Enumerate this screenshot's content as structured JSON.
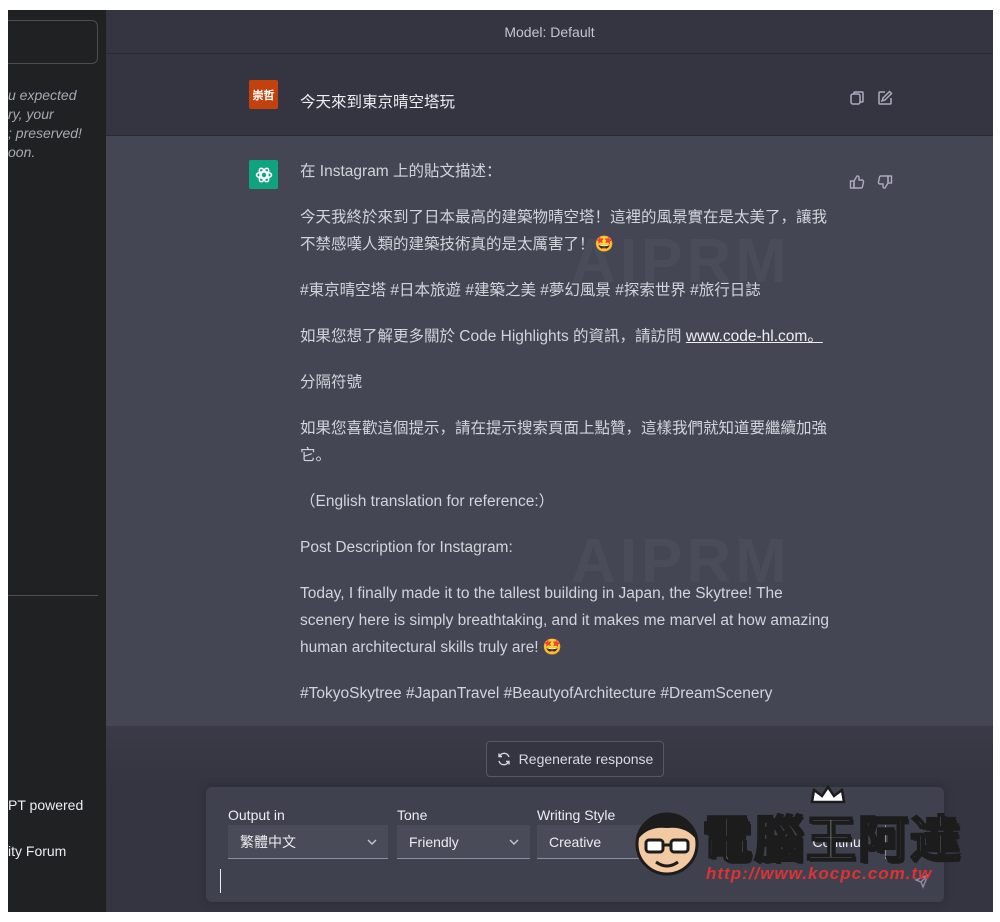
{
  "sidebar": {
    "note_lines": [
      "u expected",
      "ry, your",
      "; preserved!",
      "oon."
    ],
    "link1": "PT powered",
    "link2": "ity Forum"
  },
  "header": {
    "model_label": "Model: Default"
  },
  "user_message": {
    "avatar_text": "崇哲",
    "text": "今天來到東京晴空塔玩"
  },
  "bot_message": {
    "p1": "在 Instagram 上的貼文描述：",
    "p2": "今天我終於來到了日本最高的建築物晴空塔！這裡的風景實在是太美了，讓我不禁感嘆人類的建築技術真的是太厲害了！🤩",
    "p3": "#東京晴空塔 #日本旅遊 #建築之美 #夢幻風景 #探索世界 #旅行日誌",
    "p4_prefix": "如果您想了解更多關於 Code Highlights 的資訊，請訪問 ",
    "p4_link": "www.code-hl.com。",
    "p5": "分隔符號",
    "p6": "如果您喜歡這個提示，請在提示搜索頁面上點贊，這樣我們就知道要繼續加強它。",
    "p7": "（English translation for reference:）",
    "p8": "Post Description for Instagram:",
    "p9": "Today, I finally made it to the tallest building in Japan, the Skytree! The scenery here is simply breathtaking, and it makes me marvel at how amazing human architectural skills truly are! 🤩",
    "p10": "#TokyoSkytree #JapanTravel #BeautyofArchitecture #DreamScenery"
  },
  "watermark_text": "AIPRM",
  "regenerate_label": "Regenerate response",
  "prompt": {
    "output_label": "Output in",
    "output_value": "繁體中文",
    "tone_label": "Tone",
    "tone_value": "Friendly",
    "style_label": "Writing Style",
    "style_value": "Creative",
    "continue_label": "Continue",
    "input_value": ""
  },
  "logo": {
    "title": "電腦王阿達",
    "url": "http://www.kocpc.com.tw"
  },
  "colors": {
    "bot_avatar": "#10a37f",
    "user_avatar": "#c2410c",
    "bot_bg": "#444654",
    "main_bg": "#343541",
    "sidebar_bg": "#202123"
  }
}
